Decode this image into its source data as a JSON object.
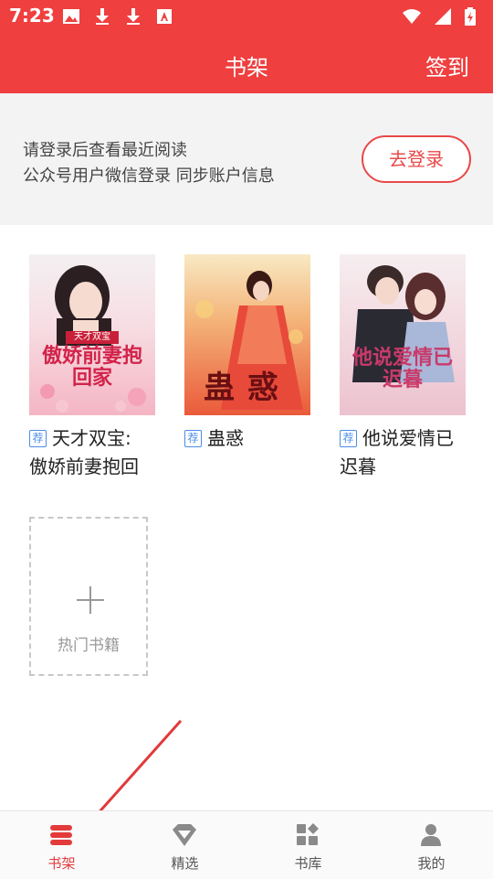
{
  "status_bar": {
    "time": "7:23"
  },
  "app_bar": {
    "title": "书架",
    "checkin": "签到"
  },
  "login_prompt": {
    "line1": "请登录后查看最近阅读",
    "line2": "公众号用户微信登录 同步账户信息",
    "button": "去登录"
  },
  "books": [
    {
      "badge": "荐",
      "title_line1": "天才双宝:",
      "title_line2": "傲娇前妻抱回",
      "cover_text": "傲娇前妻抱回家",
      "cover_tag": "天才双宝"
    },
    {
      "badge": "荐",
      "title_line1": "蛊惑",
      "title_line2": "",
      "cover_text": "蛊惑"
    },
    {
      "badge": "荐",
      "title_line1": "他说爱情已",
      "title_line2": "迟暮",
      "cover_text": "他说爱情已迟暮"
    }
  ],
  "add_book": {
    "label": "热门书籍"
  },
  "tabs": [
    {
      "label": "书架",
      "icon": "bookshelf-icon",
      "active": true
    },
    {
      "label": "精选",
      "icon": "diamond-icon"
    },
    {
      "label": "书库",
      "icon": "grid-icon"
    },
    {
      "label": "我的",
      "icon": "person-icon"
    }
  ],
  "colors": {
    "primary": "#ef3f3f",
    "badge": "#4b8de6",
    "annotation_arrow": "#e03a3a"
  }
}
